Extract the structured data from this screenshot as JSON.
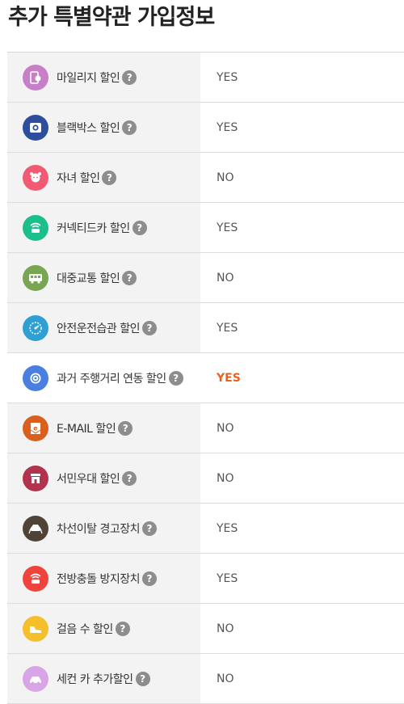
{
  "title": "추가 특별약관 가입정보",
  "colors": {
    "label_bg": "#f3f3f3",
    "accent": "#e8621e",
    "help_bg": "#8d8d8d"
  },
  "rows": [
    {
      "label": "마일리지 할인",
      "value": "YES",
      "icon": "mileage-icon",
      "icon_color": "#c77fc8"
    },
    {
      "label": "블랙박스 할인",
      "value": "YES",
      "icon": "blackbox-camera-icon",
      "icon_color": "#2c4e9d"
    },
    {
      "label": "자녀 할인",
      "value": "NO",
      "icon": "child-icon",
      "icon_color": "#f25a74"
    },
    {
      "label": "커넥티드카 할인",
      "value": "YES",
      "icon": "connected-car-icon",
      "icon_color": "#1bbf8c"
    },
    {
      "label": "대중교통 할인",
      "value": "NO",
      "icon": "bus-icon",
      "icon_color": "#78a653"
    },
    {
      "label": "안전운전습관 할인",
      "value": "YES",
      "icon": "gauge-icon",
      "icon_color": "#2f9fd4"
    },
    {
      "label": "과거 주행거리 연동 할인",
      "value": "YES",
      "icon": "odometer-icon",
      "icon_color": "#4a7fe0",
      "highlight": true
    },
    {
      "label": "E-MAIL 할인",
      "value": "NO",
      "icon": "email-icon",
      "icon_color": "#d8601c"
    },
    {
      "label": "서민우대 할인",
      "value": "NO",
      "icon": "store-icon",
      "icon_color": "#b2334e"
    },
    {
      "label": "차선이탈 경고장치",
      "value": "YES",
      "icon": "lane-departure-icon",
      "icon_color": "#4f4337"
    },
    {
      "label": "전방충돌 방지장치",
      "value": "YES",
      "icon": "collision-warning-icon",
      "icon_color": "#f0433b"
    },
    {
      "label": "걸음 수 할인",
      "value": "NO",
      "icon": "walking-shoe-icon",
      "icon_color": "#f5bf2c"
    },
    {
      "label": "세컨 카 추가할인",
      "value": "NO",
      "icon": "second-car-icon",
      "icon_color": "#d8a6e6"
    }
  ],
  "help_symbol": "?"
}
